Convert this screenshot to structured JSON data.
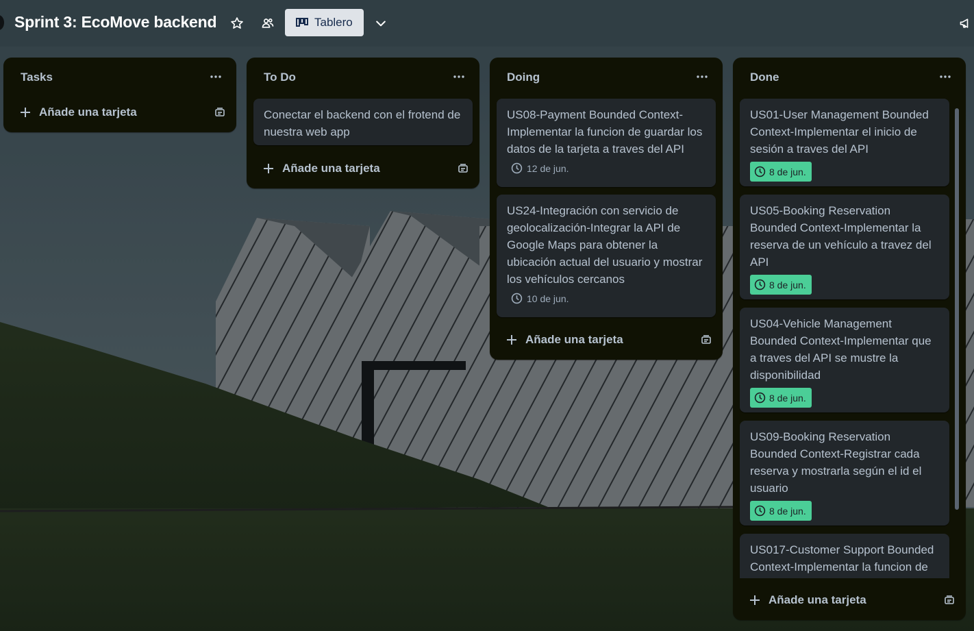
{
  "header": {
    "title": "Sprint 3: EcoMove backend",
    "view_label": "Tablero",
    "icons": [
      "star-icon",
      "workspace-visible-icon",
      "board-view-icon",
      "chevron-down-icon",
      "megaphone-icon"
    ]
  },
  "colors": {
    "list_bg": "#101204",
    "card_bg": "#22272b",
    "text": "#b6c2cf",
    "due_complete_bg": "#4bce97",
    "view_btn_bg": "#dfe3e8"
  },
  "lists": [
    {
      "title": "Tasks",
      "cards": [],
      "add_label": "Añade una tarjeta"
    },
    {
      "title": "To Do",
      "cards": [
        {
          "title": "Conectar el backend con el frotend de nuestra web app"
        }
      ],
      "add_label": "Añade una tarjeta"
    },
    {
      "title": "Doing",
      "cards": [
        {
          "title": "US08-Payment Bounded Context-Implementar la funcion de guardar los datos de la tarjeta a traves del API",
          "due": "12 de jun."
        },
        {
          "title": "US24-Integración con servicio de geolocalización-Integrar la API de Google Maps para obtener la ubicación actual del usuario y mostrar los vehículos cercanos",
          "due": "10 de jun."
        }
      ],
      "add_label": "Añade una tarjeta"
    },
    {
      "title": "Done",
      "cards": [
        {
          "title": "US01-User Management Bounded Context-Implementar el inicio de sesión a traves del API",
          "due": "8 de jun.",
          "complete": true
        },
        {
          "title": "US05-Booking Reservation Bounded Context-Implementar la reserva de un vehículo a travez del API",
          "due": "8 de jun.",
          "complete": true
        },
        {
          "title": "US04-Vehicle Management Bounded Context-Implementar que a traves del API se mustre la disponibilidad",
          "due": "8 de jun.",
          "complete": true
        },
        {
          "title": "US09-Booking Reservation Bounded Context-Registrar cada reserva y mostrarla según el id el usuario",
          "due": "8 de jun.",
          "complete": true
        },
        {
          "title": "US017-Customer Support Bounded Context-Implementar la funcion de"
        }
      ],
      "add_label": "Añade una tarjeta"
    }
  ]
}
